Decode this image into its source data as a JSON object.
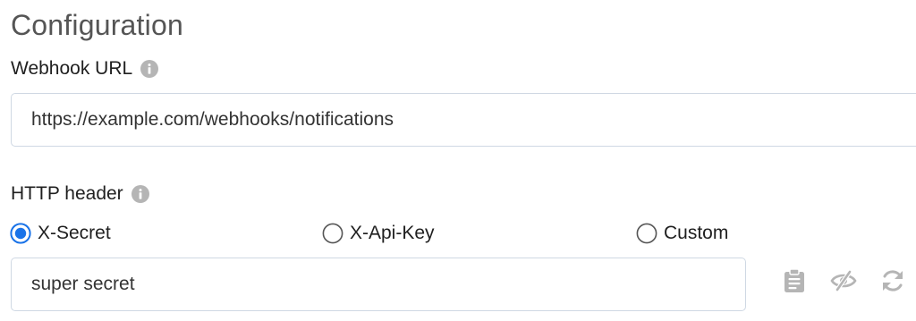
{
  "section": {
    "title": "Configuration"
  },
  "webhook": {
    "label": "Webhook URL",
    "value": "https://example.com/webhooks/notifications"
  },
  "http_header": {
    "label": "HTTP header",
    "options": [
      {
        "label": "X-Secret",
        "selected": true
      },
      {
        "label": "X-Api-Key",
        "selected": false
      },
      {
        "label": "Custom",
        "selected": false
      }
    ],
    "value": "super secret"
  },
  "colors": {
    "accent": "#1a73e8",
    "icon_gray": "#b5b5b5",
    "border": "#cfd8e3",
    "title": "#555555"
  },
  "icons": {
    "info": "info-icon",
    "copy": "clipboard-icon",
    "reveal": "eye-slash-icon",
    "regenerate": "refresh-icon"
  }
}
